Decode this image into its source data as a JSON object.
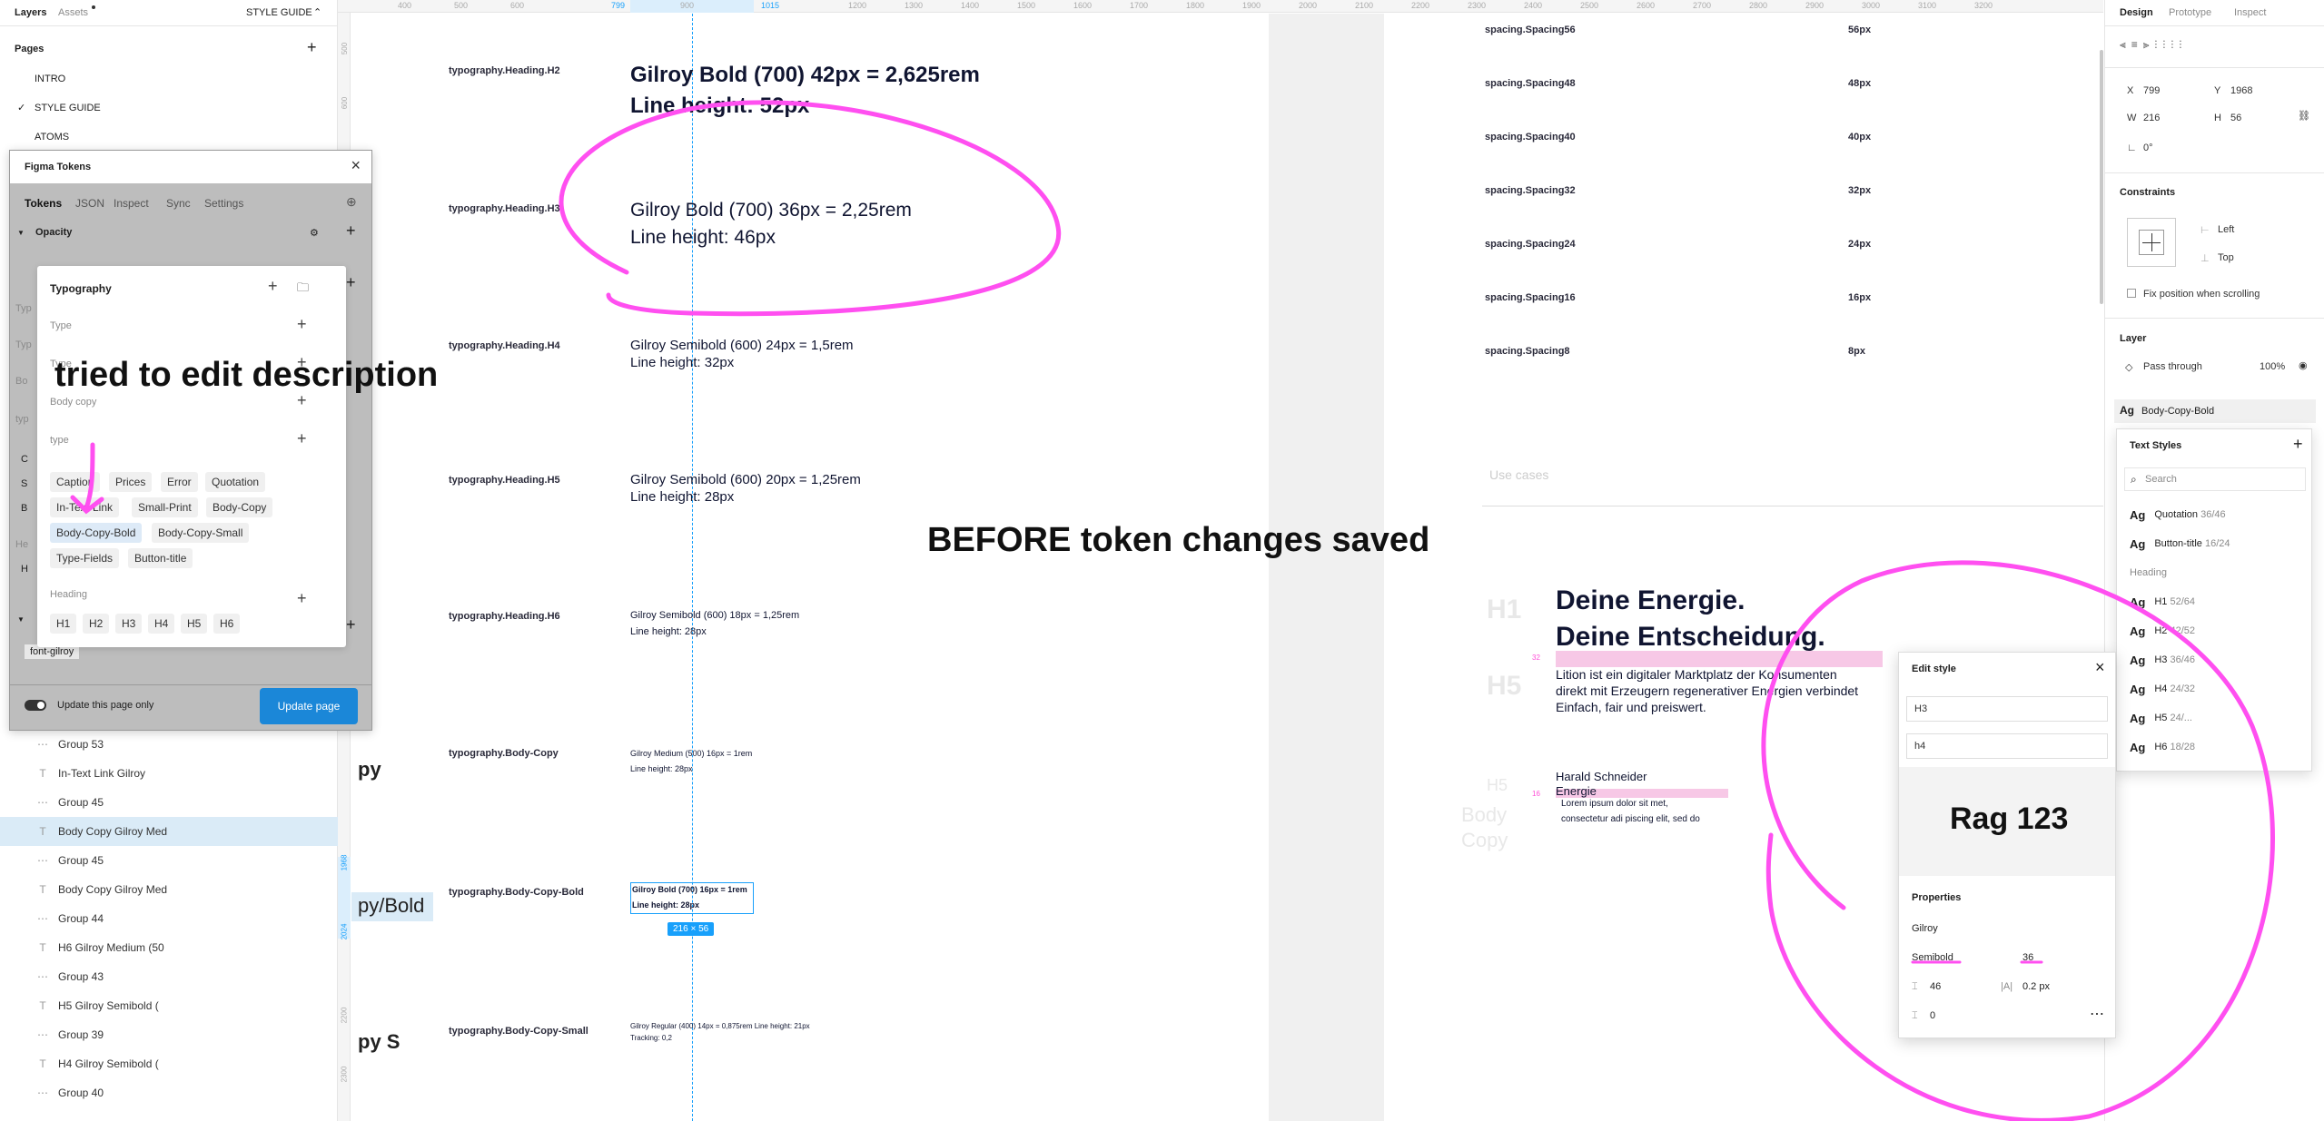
{
  "left": {
    "tabs": {
      "layers": "Layers",
      "assets": "Assets"
    },
    "style_guide_label": "STYLE GUIDE",
    "pages_title": "Pages",
    "pages": [
      "INTRO",
      "STYLE GUIDE",
      "ATOMS"
    ],
    "layers": [
      {
        "icon": "frame",
        "label": "Group 53"
      },
      {
        "icon": "text",
        "label": "In-Text Link Gilroy"
      },
      {
        "icon": "frame",
        "label": "Group 45"
      },
      {
        "icon": "text",
        "label": "Body Copy Gilroy Med"
      },
      {
        "icon": "frame",
        "label": "Group 45"
      },
      {
        "icon": "text",
        "label": "Body Copy Gilroy Med"
      },
      {
        "icon": "frame",
        "label": "Group 44"
      },
      {
        "icon": "text",
        "label": "H6 Gilroy Medium (50"
      },
      {
        "icon": "frame",
        "label": "Group 43"
      },
      {
        "icon": "text",
        "label": "H5 Gilroy Semibold ("
      },
      {
        "icon": "frame",
        "label": "Group 39"
      },
      {
        "icon": "text",
        "label": "H4 Gilroy Semibold ("
      },
      {
        "icon": "frame",
        "label": "Group 40"
      }
    ],
    "partial_labels": {
      "typ1": "Typ",
      "typ2": "Typ",
      "bo": "Bo",
      "typ3": "typ",
      "c": "C",
      "s": "S",
      "b": "B",
      "he": "He",
      "h": "H"
    }
  },
  "plugin": {
    "title": "Figma Tokens",
    "tabs": [
      "Tokens",
      "JSON",
      "Inspect",
      "Sync",
      "Settings"
    ],
    "opacity_label": "Opacity",
    "typography_title": "Typography",
    "groups": {
      "type1": "Type",
      "type2": "Type",
      "body_copy": "Body copy",
      "type3": "type",
      "heading": "Heading"
    },
    "type_chips": [
      "Caption",
      "Prices",
      "Error",
      "Quotation",
      "In-Text-Link",
      "Small-Print",
      "Body-Copy",
      "Body-Copy-Bold",
      "Body-Copy-Small",
      "Type-Fields",
      "Button-title"
    ],
    "heading_chips": [
      "H1",
      "H2",
      "H3",
      "H4",
      "H5",
      "H6"
    ],
    "font_chip": "font-gilroy",
    "update_page_only": "Update this page only",
    "update_button": "Update page"
  },
  "annotations": {
    "tried": "tried to edit description",
    "before": "BEFORE token changes saved"
  },
  "ruler": {
    "top": [
      "400",
      "500",
      "600",
      "799",
      "900",
      "1015",
      "1200",
      "1300",
      "1400",
      "1500",
      "1600",
      "1700",
      "1800",
      "1900",
      "2000",
      "2100",
      "2200",
      "2300",
      "2400",
      "2500",
      "2600",
      "2700",
      "2800",
      "2900",
      "3000",
      "3100",
      "3200"
    ],
    "left": [
      "500",
      "600",
      "1968",
      "2024",
      "2200",
      "2300"
    ]
  },
  "canvas": {
    "tokens": [
      {
        "name": "typography.Heading.H2",
        "spec1": "Gilroy Bold (700)  42px = 2,625rem",
        "spec2": "Line height: 52px"
      },
      {
        "name": "typography.Heading.H3",
        "spec1": "Gilroy Bold (700)  36px = 2,25rem",
        "spec2": "Line height: 46px"
      },
      {
        "name": "typography.Heading.H4",
        "spec1": "Gilroy Semibold (600)  24px = 1,5rem",
        "spec2": "Line height: 32px"
      },
      {
        "name": "typography.Heading.H5",
        "spec1": "Gilroy Semibold (600)  20px = 1,25rem",
        "spec2": "Line height: 28px"
      },
      {
        "name": "typography.Heading.H6",
        "spec1": "Gilroy Semibold (600)  18px = 1,25rem",
        "spec2": "Line height: 28px"
      },
      {
        "name": "typography.Body-Copy",
        "spec1": "Gilroy Medium (500)  16px = 1rem",
        "spec2": "Line height: 28px"
      },
      {
        "name": "typography.Body-Copy-Bold",
        "spec1": "Gilroy Bold (700) 16px = 1rem",
        "spec2": "Line height: 28px"
      },
      {
        "name": "typography.Body-Copy-Small",
        "spec1": "Gilroy Regular (400)  14px = 0,875rem Line height: 21px",
        "spec2": "Tracking: 0,2"
      }
    ],
    "left_partials": {
      "py": "py",
      "pybold": "py/Bold",
      "pys": "py S"
    },
    "selection_size": "216 × 56",
    "spacing": [
      {
        "name": "spacing.Spacing56",
        "value": "56px"
      },
      {
        "name": "spacing.Spacing48",
        "value": "48px"
      },
      {
        "name": "spacing.Spacing40",
        "value": "40px"
      },
      {
        "name": "spacing.Spacing32",
        "value": "32px"
      },
      {
        "name": "spacing.Spacing24",
        "value": "24px"
      },
      {
        "name": "spacing.Spacing16",
        "value": "16px"
      },
      {
        "name": "spacing.Spacing8",
        "value": "8px"
      }
    ],
    "use_cases": "Use cases",
    "h1_label": "H1",
    "h5_label": "H5",
    "h5_label2": "H5",
    "body_label": "Body",
    "copy_label": "Copy",
    "num32": "32",
    "num16": "16",
    "headline1": "Deine Energie.",
    "headline2": "Deine Entscheidung.",
    "paragraph1": "Lition ist ein digitaler Marktplatz der Konsumenten",
    "paragraph2": "direkt mit Erzeugern regenerativer Energien verbindet",
    "paragraph3": "Einfach, fair und preiswert.",
    "name_line": "Harald Schneider",
    "energie": "Energie",
    "lorem1": "Lorem ipsum dolor sit met,",
    "lorem2": "consectetur adi piscing elit, sed do"
  },
  "design": {
    "tabs": [
      "Design",
      "Prototype",
      "Inspect"
    ],
    "x_label": "X",
    "x": "799",
    "y_label": "Y",
    "y": "1968",
    "w_label": "W",
    "w": "216",
    "h_label": "H",
    "h": "56",
    "rotation": "0°",
    "constraints_title": "Constraints",
    "constraint_h": "Left",
    "constraint_v": "Top",
    "fix_position": "Fix position when scrolling",
    "layer_title": "Layer",
    "blend": "Pass through",
    "opacity": "100%",
    "text_style_current": "Body-Copy-Bold",
    "text_styles_title": "Text Styles",
    "search_placeholder": "Search",
    "styles": [
      {
        "name": "Quotation",
        "meta": "36/46"
      },
      {
        "name": "Button-title",
        "meta": "16/24"
      }
    ],
    "heading_group": "Heading",
    "heading_styles": [
      {
        "name": "H1",
        "meta": "52/64"
      },
      {
        "name": "H2",
        "meta": "42/52"
      },
      {
        "name": "H3",
        "meta": "36/46"
      },
      {
        "name": "H4",
        "meta": "24/32"
      },
      {
        "name": "H5",
        "meta": "24/..."
      },
      {
        "name": "H6",
        "meta": "18/28"
      }
    ]
  },
  "edit_style": {
    "title": "Edit style",
    "name_value": "H3",
    "description_value": "h4",
    "preview": "Rag 123",
    "properties_title": "Properties",
    "font_family": "Gilroy",
    "font_weight": "Semibold",
    "font_size": "36",
    "line_height": "46",
    "letter_spacing": "0.2 px",
    "paragraph_spacing": "0"
  },
  "colors": {
    "accent": "#18a0fb",
    "annotation": "#ff4ff0",
    "update_button": "#1b87d8",
    "highlight": "#f7c8e6"
  }
}
